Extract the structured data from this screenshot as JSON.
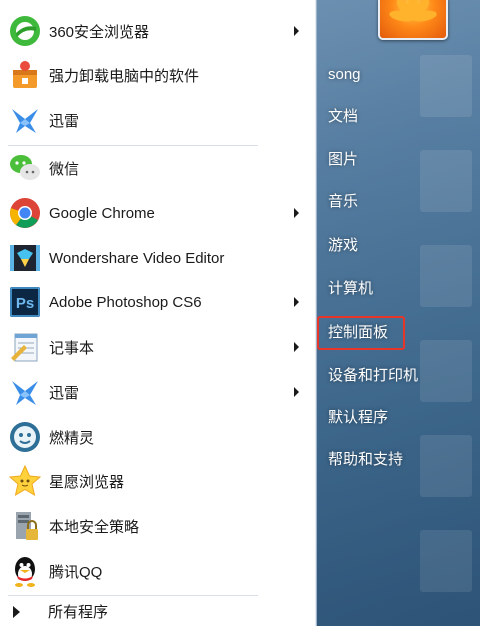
{
  "programs": [
    {
      "label": "360安全浏览器",
      "icon": "360-browser-icon",
      "has_arrow": true
    },
    {
      "label": "强力卸载电脑中的软件",
      "icon": "uninstall-icon",
      "has_arrow": false
    },
    {
      "label": "迅雷",
      "icon": "xunlei-icon",
      "has_arrow": false
    },
    {
      "label": "微信",
      "icon": "wechat-icon",
      "has_arrow": false
    },
    {
      "label": "Google Chrome",
      "icon": "chrome-icon",
      "has_arrow": true
    },
    {
      "label": "Wondershare Video Editor",
      "icon": "video-editor-icon",
      "has_arrow": false
    },
    {
      "label": "Adobe Photoshop CS6",
      "icon": "photoshop-icon",
      "has_arrow": true
    },
    {
      "label": "记事本",
      "icon": "notepad-icon",
      "has_arrow": true
    },
    {
      "label": "迅雷",
      "icon": "xunlei-icon",
      "has_arrow": true
    },
    {
      "label": "燃精灵",
      "icon": "ranjingling-icon",
      "has_arrow": false
    },
    {
      "label": "星愿浏览器",
      "icon": "twinkstar-browser-icon",
      "has_arrow": false
    },
    {
      "label": "本地安全策略",
      "icon": "security-policy-icon",
      "has_arrow": false
    },
    {
      "label": "腾讯QQ",
      "icon": "qq-icon",
      "has_arrow": false
    }
  ],
  "all_programs_label": "所有程序",
  "right_pane": [
    "song",
    "文档",
    "图片",
    "音乐",
    "游戏",
    "计算机",
    "控制面板",
    "设备和打印机",
    "默认程序",
    "帮助和支持"
  ],
  "highlight_color": "#e8352a"
}
